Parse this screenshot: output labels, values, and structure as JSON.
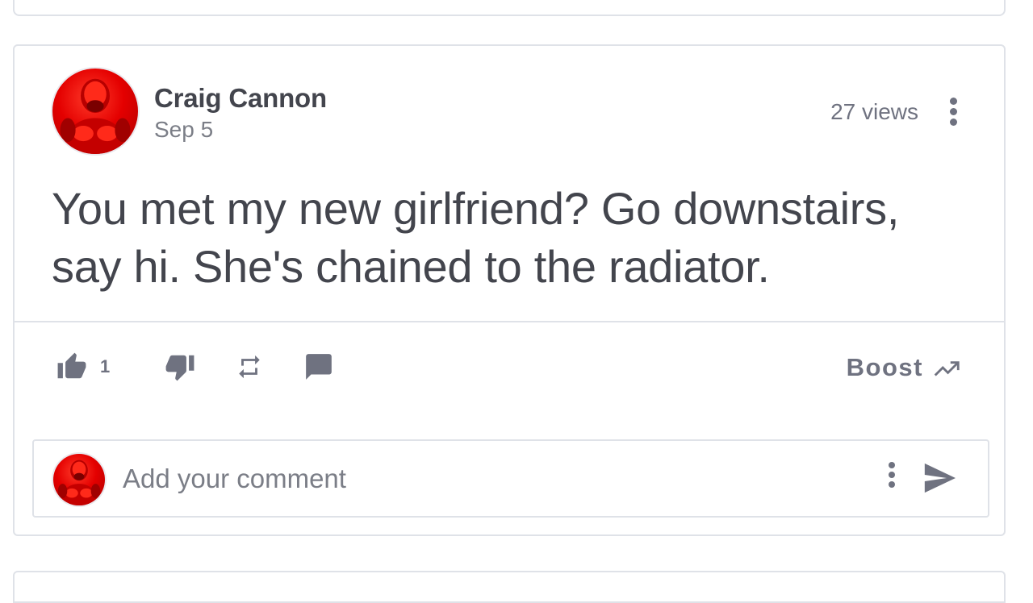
{
  "post": {
    "author": "Craig Cannon",
    "date": "Sep 5",
    "views": "27 views",
    "text": "You met my new girlfriend? Go downstairs, say hi. She's chained to the radiator."
  },
  "actions": {
    "thumbs_up_count": "1",
    "boost_label": "Boost",
    "icons": [
      "thumb-up-icon",
      "thumb-down-icon",
      "remind-icon",
      "comment-icon",
      "trending-up-icon"
    ]
  },
  "comment_box": {
    "placeholder": "Add your comment",
    "icons": [
      "more-vert-icon",
      "send-icon"
    ]
  },
  "colors": {
    "text": "#43454d",
    "muted": "#6f7280",
    "border": "#dfe2e8",
    "avatar_red": "#e40000"
  }
}
